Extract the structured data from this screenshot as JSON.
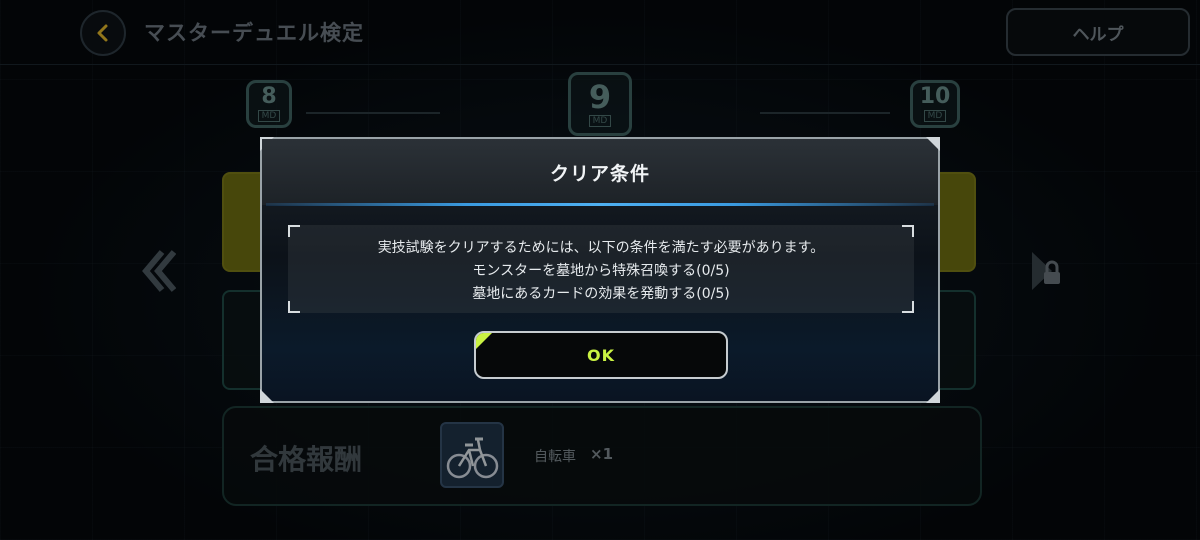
{
  "header": {
    "title": "マスターデュエル検定",
    "help_label": "ヘルプ"
  },
  "ranks": [
    {
      "number": "8",
      "tag": "MD"
    },
    {
      "number": "9",
      "tag": "MD"
    },
    {
      "number": "10",
      "tag": "MD"
    }
  ],
  "reward": {
    "title": "合格報酬",
    "item_name": "自転車",
    "item_qty": "×1"
  },
  "dialog": {
    "title": "クリア条件",
    "lines": [
      "実技試験をクリアするためには、以下の条件を満たす必要があります。",
      "モンスターを墓地から特殊召喚する(0/5)",
      "墓地にあるカードの効果を発動する(0/5)"
    ],
    "ok_label": "OK"
  },
  "colors": {
    "accent": "#c9f243",
    "separator": "#3a9ae0",
    "rank": "#3f6362",
    "back_arrow": "#e0b52a"
  },
  "icons": [
    "back-arrow-icon",
    "lock-icon",
    "chevron-left-icon",
    "bicycle-icon"
  ]
}
